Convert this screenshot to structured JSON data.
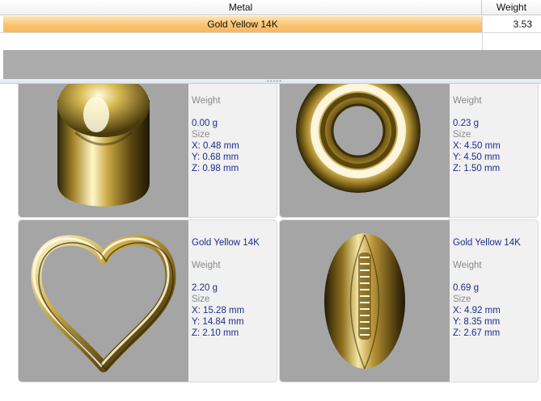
{
  "grid": {
    "columns": {
      "metal": "Metal",
      "weight": "Weight"
    },
    "rows": [
      {
        "metal": "Gold Yellow 14K",
        "weight": "3.53",
        "selected": true
      }
    ]
  },
  "colors": {
    "selection_gradient_top": "#fde6b8",
    "selection_gradient_bottom": "#f8b75c",
    "value_text": "#1d2c8c",
    "label_text": "#8a8a8a",
    "gold": "#c9a43a"
  },
  "parts": [
    {
      "shape": "barrel-bead-icon",
      "metal": "",
      "weight_label": "Weight",
      "weight": "0.00 g",
      "size_label": "Size",
      "x": "X: 0.48 mm",
      "y": "Y: 0.68 mm",
      "z": "Z: 0.98 mm"
    },
    {
      "shape": "donut-ring-icon",
      "metal": "",
      "weight_label": "Weight",
      "weight": "0.23 g",
      "size_label": "Size",
      "x": "X: 4.50 mm",
      "y": "Y: 4.50 mm",
      "z": "Z: 1.50 mm"
    },
    {
      "shape": "heart-frame-icon",
      "metal": "Gold Yellow 14K",
      "weight_label": "Weight",
      "weight": "2.20 g",
      "size_label": "Size",
      "x": "X: 15.28 mm",
      "y": "Y: 14.84 mm",
      "z": "Z: 2.10 mm"
    },
    {
      "shape": "football-charm-icon",
      "metal": "Gold Yellow 14K",
      "weight_label": "Weight",
      "weight": "0.69 g",
      "size_label": "Size",
      "x": "X: 4.92 mm",
      "y": "Y: 8.35 mm",
      "z": "Z: 2.67 mm"
    }
  ]
}
